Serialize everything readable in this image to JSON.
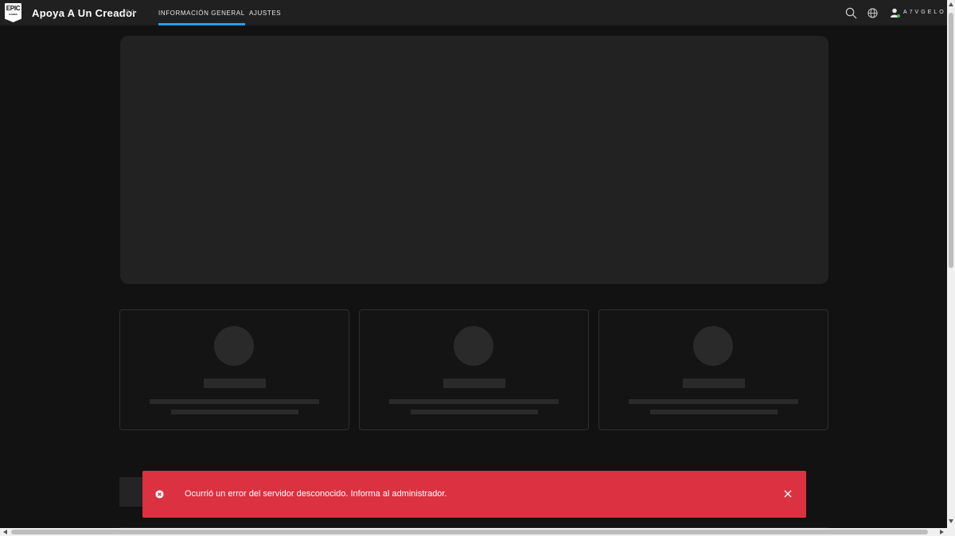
{
  "header": {
    "logo_text": "EPIC",
    "logo_subtext": "GAMES",
    "title": "Apoya A Un Creador",
    "version": "v2.0",
    "tabs": [
      {
        "label": "INFORMACIÓN GENERAL",
        "active": true
      },
      {
        "label": "AJUSTES",
        "active": false
      }
    ],
    "icons": [
      "search-icon",
      "globe-icon",
      "user-icon"
    ],
    "username": "A7VGELO"
  },
  "toast": {
    "type": "error",
    "message": "Ocurrió un error del servidor desconocido. Informa al administrador.",
    "icon": "error-circle-icon",
    "close_icon": "close-icon"
  },
  "colors": {
    "background": "#121212",
    "header": "#202020",
    "accent": "#2a9ce8",
    "error": "#dc3140",
    "skeleton": "#222222"
  }
}
